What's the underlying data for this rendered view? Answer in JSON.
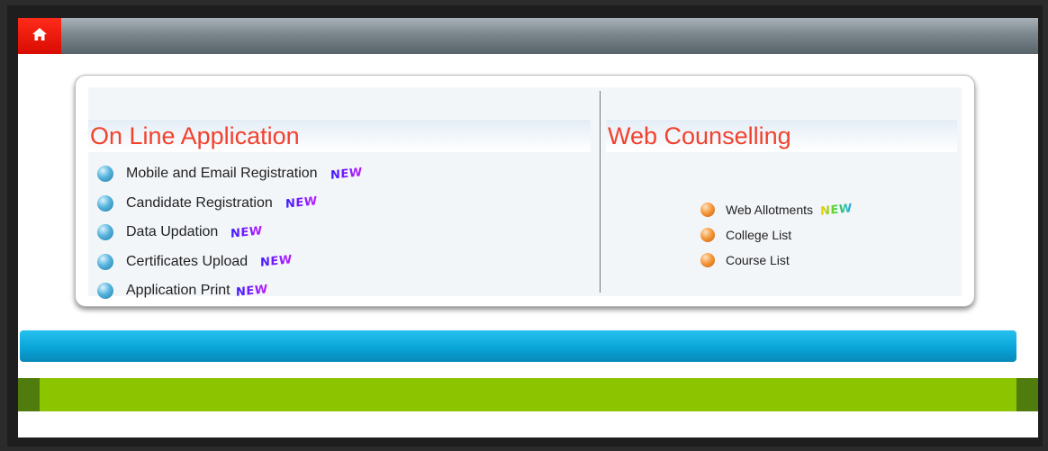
{
  "header": {
    "home_icon": "home-icon",
    "accent_color": "#e61206"
  },
  "online_application": {
    "title": "On Line Application",
    "items": [
      {
        "label": "Mobile and Email Registration",
        "badge": "NEW"
      },
      {
        "label": "Candidate Registration",
        "badge": "NEW"
      },
      {
        "label": "Data Updation",
        "badge": "NEW"
      },
      {
        "label": "Certificates Upload",
        "badge": "NEW"
      },
      {
        "label": "Application Print",
        "badge": "NEW"
      }
    ]
  },
  "web_counselling": {
    "title": "Web Counselling",
    "items": [
      {
        "label": "Web Allotments",
        "badge": "NEW"
      },
      {
        "label": "College List"
      },
      {
        "label": "Course List"
      }
    ]
  },
  "colors": {
    "title_red": "#f2412d",
    "blue_bar": "#0aa5d8",
    "green_bar": "#8dc400"
  }
}
